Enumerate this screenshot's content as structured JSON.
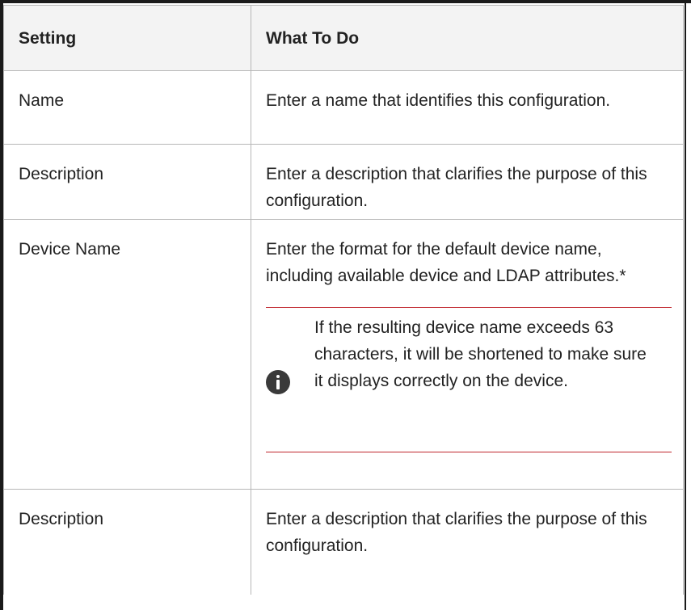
{
  "table": {
    "headers": {
      "setting": "Setting",
      "what_to_do": "What To Do"
    },
    "rows": [
      {
        "setting": "Name",
        "what_to_do": "Enter a name that identifies this configuration."
      },
      {
        "setting": "Description",
        "what_to_do": "Enter a description that clarifies the purpose of this configuration."
      },
      {
        "setting": "Device Name",
        "what_to_do": "Enter the format for the default device name, including available device and LDAP attributes.*",
        "note": {
          "icon": "info-icon",
          "text": "If the resulting device name exceeds 63 characters, it will be shortened to make sure it displays correctly on the device.",
          "accent_color": "#c0262d"
        }
      },
      {
        "setting": "Description",
        "what_to_do": "Enter a description that clarifies the purpose of this configuration."
      }
    ]
  }
}
